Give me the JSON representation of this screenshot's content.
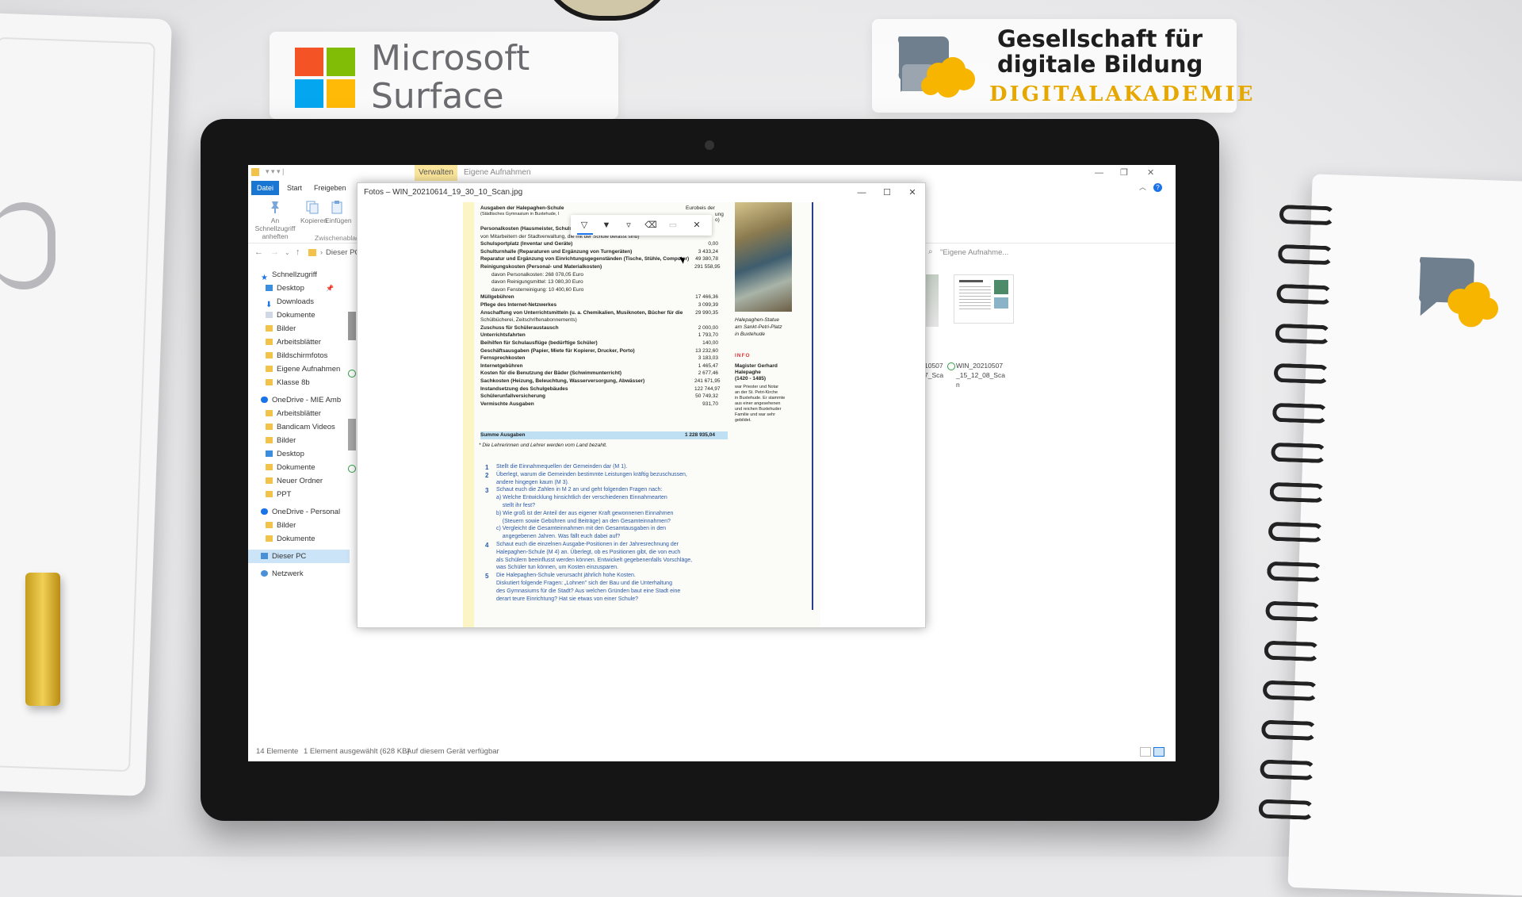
{
  "decor": {
    "ms_brand_line1": "Microsoft",
    "ms_brand_line2": "Surface",
    "gfdb_line1": "Gesellschaft für",
    "gfdb_line2": "digitale Bildung",
    "gfdb_line3": "DIGITALAKADEMIE",
    "colors": {
      "ms_red": "#f35325",
      "ms_green": "#81bc06",
      "ms_blue": "#05a6f0",
      "ms_yellow": "#ffba08",
      "gfdb_yellow": "#f7b500",
      "gfdb_gray": "#6f7f8e"
    }
  },
  "explorer": {
    "context_tab": "Verwalten",
    "window_title": "Eigene Aufnahmen",
    "ribbon_tabs": [
      "Datei",
      "Start",
      "Freigeben"
    ],
    "ribbon_buttons": [
      {
        "label": "An Schnellzugriff anheften",
        "icon": "pin-icon"
      },
      {
        "label": "Kopieren",
        "icon": "copy-icon"
      },
      {
        "label": "Einfügen",
        "icon": "paste-icon"
      }
    ],
    "ribbon_group": "Zwischenablage",
    "address": "Dieser PC",
    "search_placeholder": "\"Eigene Aufnahme...",
    "sidebar": [
      {
        "label": "Schnellzugriff",
        "icon": "star-icon",
        "level": 0
      },
      {
        "label": "Desktop",
        "icon": "folder-blue-icon",
        "level": 1
      },
      {
        "label": "Downloads",
        "icon": "download-icon",
        "level": 1
      },
      {
        "label": "Dokumente",
        "icon": "document-icon",
        "level": 1
      },
      {
        "label": "Bilder",
        "icon": "folder-icon",
        "level": 1
      },
      {
        "label": "Arbeitsblätter",
        "icon": "folder-icon",
        "level": 1
      },
      {
        "label": "Bildschirmfotos",
        "icon": "folder-icon",
        "level": 1
      },
      {
        "label": "Eigene Aufnahmen",
        "icon": "folder-icon",
        "level": 1
      },
      {
        "label": "Klasse 8b",
        "icon": "folder-icon",
        "level": 1
      },
      {
        "label": "OneDrive - MIE Amb",
        "icon": "cloud-icon",
        "level": 0
      },
      {
        "label": "Arbeitsblätter",
        "icon": "folder-icon",
        "level": 1
      },
      {
        "label": "Bandicam Videos",
        "icon": "folder-icon",
        "level": 1
      },
      {
        "label": "Bilder",
        "icon": "folder-icon",
        "level": 1
      },
      {
        "label": "Desktop",
        "icon": "folder-blue-icon",
        "level": 1
      },
      {
        "label": "Dokumente",
        "icon": "folder-icon",
        "level": 1
      },
      {
        "label": "Neuer Ordner",
        "icon": "folder-icon",
        "level": 1
      },
      {
        "label": "PPT",
        "icon": "folder-icon",
        "level": 1
      },
      {
        "label": "OneDrive - Personal",
        "icon": "cloud-icon",
        "level": 0
      },
      {
        "label": "Bilder",
        "icon": "folder-icon",
        "level": 1
      },
      {
        "label": "Dokumente",
        "icon": "folder-icon",
        "level": 1
      },
      {
        "label": "Dieser PC",
        "icon": "pc-icon",
        "level": 0,
        "selected": true
      },
      {
        "label": "Netzwerk",
        "icon": "network-icon",
        "level": 0
      }
    ],
    "files_right": [
      {
        "label": "10507\n7_Sca"
      },
      {
        "label": "WIN_20210507\n_15_12_08_Sca\nn"
      }
    ],
    "status": {
      "count": "14 Elemente",
      "selection": "1 Element ausgewählt (628 KB)",
      "availability": "Auf diesem Gerät verfügbar"
    }
  },
  "photos": {
    "title": "Fotos – WIN_20210614_19_30_10_Scan.jpg",
    "toolbar_icons": [
      "ballpoint-pen-icon",
      "pencil-icon",
      "highlighter-icon",
      "eraser-icon",
      "ruler-icon",
      "close-icon"
    ],
    "doc": {
      "heading": "Ausgaben der Halepaghen-Schule",
      "subheading": "(Städtisches Gymnasium in Buxtehude, I",
      "heading_right": "Eurobeis der",
      "heading_right2": "ung",
      "heading_right3": "o)",
      "rows": [
        {
          "label": "Personalkosten (Hausmeister, Schulsek",
          "value": ""
        },
        {
          "label": "von Mitarbeitern der Stadtverwaltung, die mit der Schule befasst sind)",
          "value": ""
        },
        {
          "label": "Schulsportplatz (Inventar und Geräte)",
          "value": "0,00"
        },
        {
          "label": "Schulturnhalle (Reparaturen und Ergänzung von Turngeräten)",
          "value": "3 433,24"
        },
        {
          "label": "Reparatur und Ergänzung von Einrichtungsgegenständen (Tische, Stühle, Computer)",
          "value": "49 380,78"
        },
        {
          "label": "Reinigungskosten (Personal- und Materialkosten)",
          "value": "291 558,95"
        },
        {
          "label": "davon Personalkosten:        268 078,05 Euro",
          "value": ""
        },
        {
          "label": "davon Reinigungsmittel:       13 080,30 Euro",
          "value": ""
        },
        {
          "label": "davon Fensterreinigung:       10 400,60 Euro",
          "value": ""
        },
        {
          "label": "Müllgebühren",
          "value": "17 466,36"
        },
        {
          "label": "Pflege des Internet-Netzwerkes",
          "value": "3 099,39"
        },
        {
          "label": "Anschaffung von Unterrichtsmitteln (u. a. Chemikalien, Musiknoten, Bücher für die",
          "value": "29 990,35"
        },
        {
          "label": "Schülbücherei, Zeitschriftenabonnements)",
          "value": ""
        },
        {
          "label": "Zuschuss für Schüleraustausch",
          "value": "2 000,00"
        },
        {
          "label": "Unterrichtsfahrten",
          "value": "1 793,70"
        },
        {
          "label": "Beihilfen für Schulausflüge (bedürftige Schüler)",
          "value": "140,00"
        },
        {
          "label": "Geschäftsausgaben (Papier, Miete für Kopierer, Drucker, Porto)",
          "value": "13 232,60"
        },
        {
          "label": "Fernsprechkosten",
          "value": "3 183,03"
        },
        {
          "label": "Internetgebühren",
          "value": "1 465,47"
        },
        {
          "label": "Kosten für die Benutzung der Bäder (Schwimmunterricht)",
          "value": "2 677,46"
        },
        {
          "label": "Sachkosten (Heizung, Beleuchtung, Wasserversorgung, Abwässer)",
          "value": "241 671,95"
        },
        {
          "label": "Instandsetzung des Schulgebäudes",
          "value": "122 744,97"
        },
        {
          "label": "Schülerunfallversicherung",
          "value": "50 749,32"
        },
        {
          "label": "Vermischte Ausgaben",
          "value": "931,70"
        }
      ],
      "sum_label": "Summe Ausgaben",
      "sum_value": "1 228 935,04",
      "footnote": "* Die Lehrerinnen und Lehrer werden vom Land bezahlt.",
      "caption": "Halepaghen-Statue\nam Sankt-Petri-Platz\nin Buxtehude",
      "info_label": "INFO",
      "info_title": "Magister Gerhard\nHalepaghe\n(1420 - 1485)",
      "info_text": "war Priester und Notar\nan der St. Petri-Kirche\nin Buxtehude. Er stammte\naus einer angesehenen\nund reichen Buxtehuder\nFamilie und war sehr\ngebildet.",
      "tasks": [
        {
          "num": "1",
          "text": "Stellt die Einnahmequellen der Gemeinden dar (M 1)."
        },
        {
          "num": "2",
          "text": "Überlegt, warum die Gemeinden bestimmte Leistungen kräftig bezuschussen,"
        },
        {
          "num": "",
          "text": "andere hingegen kaum (M 3)."
        },
        {
          "num": "3",
          "text": "Schaut euch die Zahlen in M 2 an und geht folgenden Fragen nach:"
        },
        {
          "num": "",
          "text": "a) Welche Entwicklung hinsichtlich der verschiedenen Einnahmearten"
        },
        {
          "num": "",
          "text": "    stellt ihr fest?"
        },
        {
          "num": "",
          "text": "b) Wie groß ist der Anteil der aus eigener Kraft gewonnenen Einnahmen"
        },
        {
          "num": "",
          "text": "    (Steuern sowie Gebühren und Beiträge) an den Gesamteinnahmen?"
        },
        {
          "num": "",
          "text": "c) Vergleicht die Gesamteinnahmen mit den Gesamtausgaben in den"
        },
        {
          "num": "",
          "text": "    angegebenen Jahren. Was fällt euch dabei auf?"
        },
        {
          "num": "4",
          "text": "Schaut euch die einzelnen Ausgabe-Positionen in der Jahresrechnung der"
        },
        {
          "num": "",
          "text": "Halepaghen-Schule (M 4) an. Überlegt, ob es Positionen gibt, die von euch"
        },
        {
          "num": "",
          "text": "als Schülern beeinflusst werden können. Entwickelt gegebenenfalls Vorschläge,"
        },
        {
          "num": "",
          "text": "was Schüler tun können, um Kosten einzusparen."
        },
        {
          "num": "5",
          "text": "Die Halepaghen-Schule verursacht jährlich hohe Kosten."
        },
        {
          "num": "",
          "text": "Diskutiert folgende Fragen: „Lohnen\" sich der Bau und die Unterhaltung"
        },
        {
          "num": "",
          "text": "des Gymnasiums für die Stadt? Aus welchen Gründen baut eine Stadt eine"
        },
        {
          "num": "",
          "text": "derart teure Einrichtung? Hat sie etwas von einer Schule?"
        }
      ]
    }
  }
}
